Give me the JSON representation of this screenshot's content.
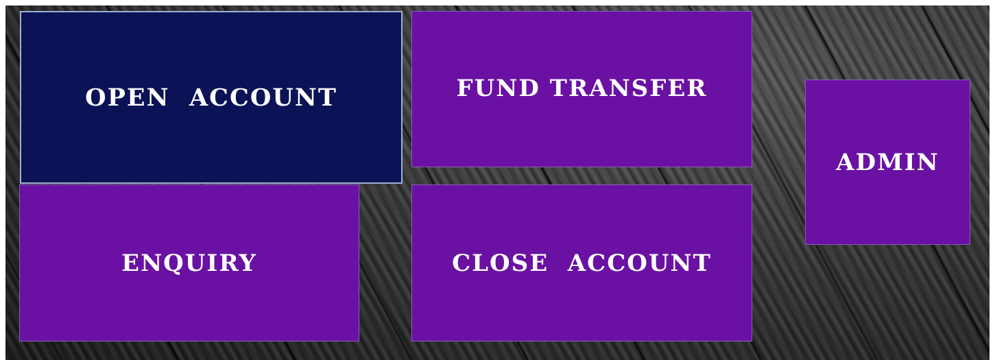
{
  "menu": {
    "tiles": [
      {
        "id": "open_account",
        "label": "OPEN  ACCOUNT",
        "selected": true
      },
      {
        "id": "fund_transfer",
        "label": "FUND TRANSFER",
        "selected": false
      },
      {
        "id": "enquiry",
        "label": "ENQUIRY",
        "selected": false
      },
      {
        "id": "close_account",
        "label": "CLOSE  ACCOUNT",
        "selected": false
      },
      {
        "id": "admin",
        "label": "ADMIN",
        "selected": false
      }
    ]
  },
  "colors": {
    "tile": "#6a11a3",
    "tile_selected": "#0b1256",
    "tile_selected_border": "#9fb1d6",
    "label": "#ffffff"
  }
}
